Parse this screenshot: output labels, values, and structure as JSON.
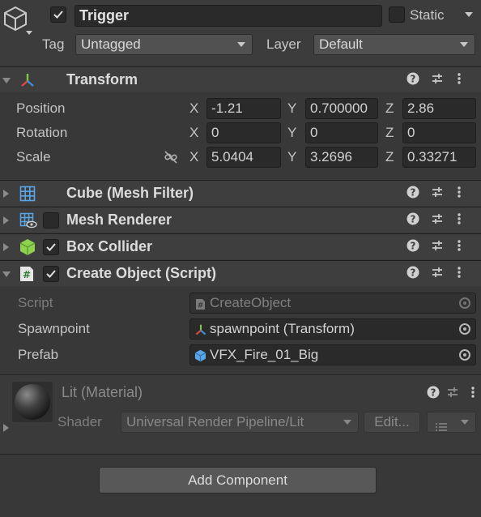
{
  "gameobject": {
    "active": true,
    "name": "Trigger",
    "static_label": "Static",
    "static_checked": false,
    "tag_label": "Tag",
    "tag_value": "Untagged",
    "layer_label": "Layer",
    "layer_value": "Default"
  },
  "transform": {
    "title": "Transform",
    "expanded": true,
    "rows": [
      {
        "label": "Position",
        "x": "-1.21",
        "y": "0.700000",
        "z": "2.86"
      },
      {
        "label": "Rotation",
        "x": "0",
        "y": "0",
        "z": "0"
      },
      {
        "label": "Scale",
        "x": "5.0404",
        "y": "3.2696",
        "z": "0.33271"
      }
    ],
    "axis_x": "X",
    "axis_y": "Y",
    "axis_z": "Z"
  },
  "components": {
    "mesh_filter": {
      "title": "Cube (Mesh Filter)"
    },
    "mesh_renderer": {
      "title": "Mesh Renderer",
      "enabled": false
    },
    "box_collider": {
      "title": "Box Collider",
      "enabled": true
    },
    "script": {
      "title": "Create Object (Script)",
      "enabled": true,
      "fields": [
        {
          "label": "Script",
          "value": "CreateObject",
          "disabled": true
        },
        {
          "label": "Spawnpoint",
          "value": "spawnpoint (Transform)"
        },
        {
          "label": "Prefab",
          "value": "VFX_Fire_01_Big"
        }
      ]
    }
  },
  "material": {
    "title": "Lit (Material)",
    "shader_label": "Shader",
    "shader_value": "Universal Render Pipeline/Lit",
    "edit_label": "Edit..."
  },
  "add_component_label": "Add Component",
  "colors": {
    "background": "#383838",
    "header": "#3e3e3e",
    "field": "#2a2a2a",
    "transform_icon_red": "#e0483e",
    "transform_icon_green": "#7ac943",
    "transform_icon_blue": "#3d8fe0",
    "collider_green": "#8fd14f",
    "mesh_icon_blue": "#5aa6e6"
  },
  "icons": [
    "gameobject-cube-icon",
    "transform-axes-icon",
    "help-icon",
    "preset-icon",
    "kebab-menu-icon",
    "grid-mesh-icon",
    "mesh-renderer-icon",
    "box-collider-icon",
    "script-hash-icon",
    "link-scale-icon",
    "object-picker-icon",
    "material-sphere-icon"
  ]
}
